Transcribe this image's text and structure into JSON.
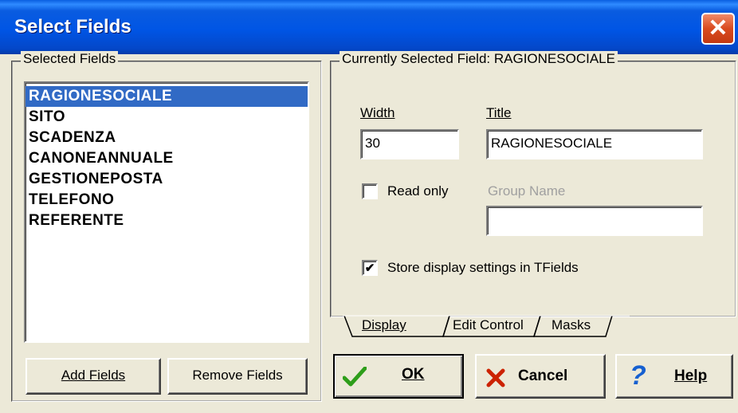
{
  "window": {
    "title": "Select Fields",
    "close_glyph": "✕"
  },
  "selected_fields": {
    "legend": "Selected Fields",
    "items": [
      "RAGIONESOCIALE",
      "SITO",
      "SCADENZA",
      "CANONEANNUALE",
      "GESTIONEPOSTA",
      "TELEFONO",
      "REFERENTE"
    ],
    "selected_index": 0
  },
  "current_field": {
    "legend": "Currently Selected Field: RAGIONESOCIALE",
    "width_label": "Width",
    "width_value": "30",
    "title_label": "Title",
    "title_value": "RAGIONESOCIALE",
    "read_only_label": "Read only",
    "read_only_checked": false,
    "group_name_label": "Group Name",
    "group_name_value": "",
    "store_label": "Store display settings in TFields",
    "store_checked": true
  },
  "tabs": [
    "Display",
    "Edit Control",
    "Masks"
  ],
  "buttons": {
    "add_fields": "Add Fields",
    "remove_fields": "Remove Fields",
    "ok": "OK",
    "cancel": "Cancel",
    "help": "Help"
  },
  "colors": {
    "title_blue": "#0055e5",
    "selection": "#316ac5",
    "ok_green": "#2e9e1a",
    "cancel_red": "#cc2200",
    "help_blue": "#1660d0"
  }
}
